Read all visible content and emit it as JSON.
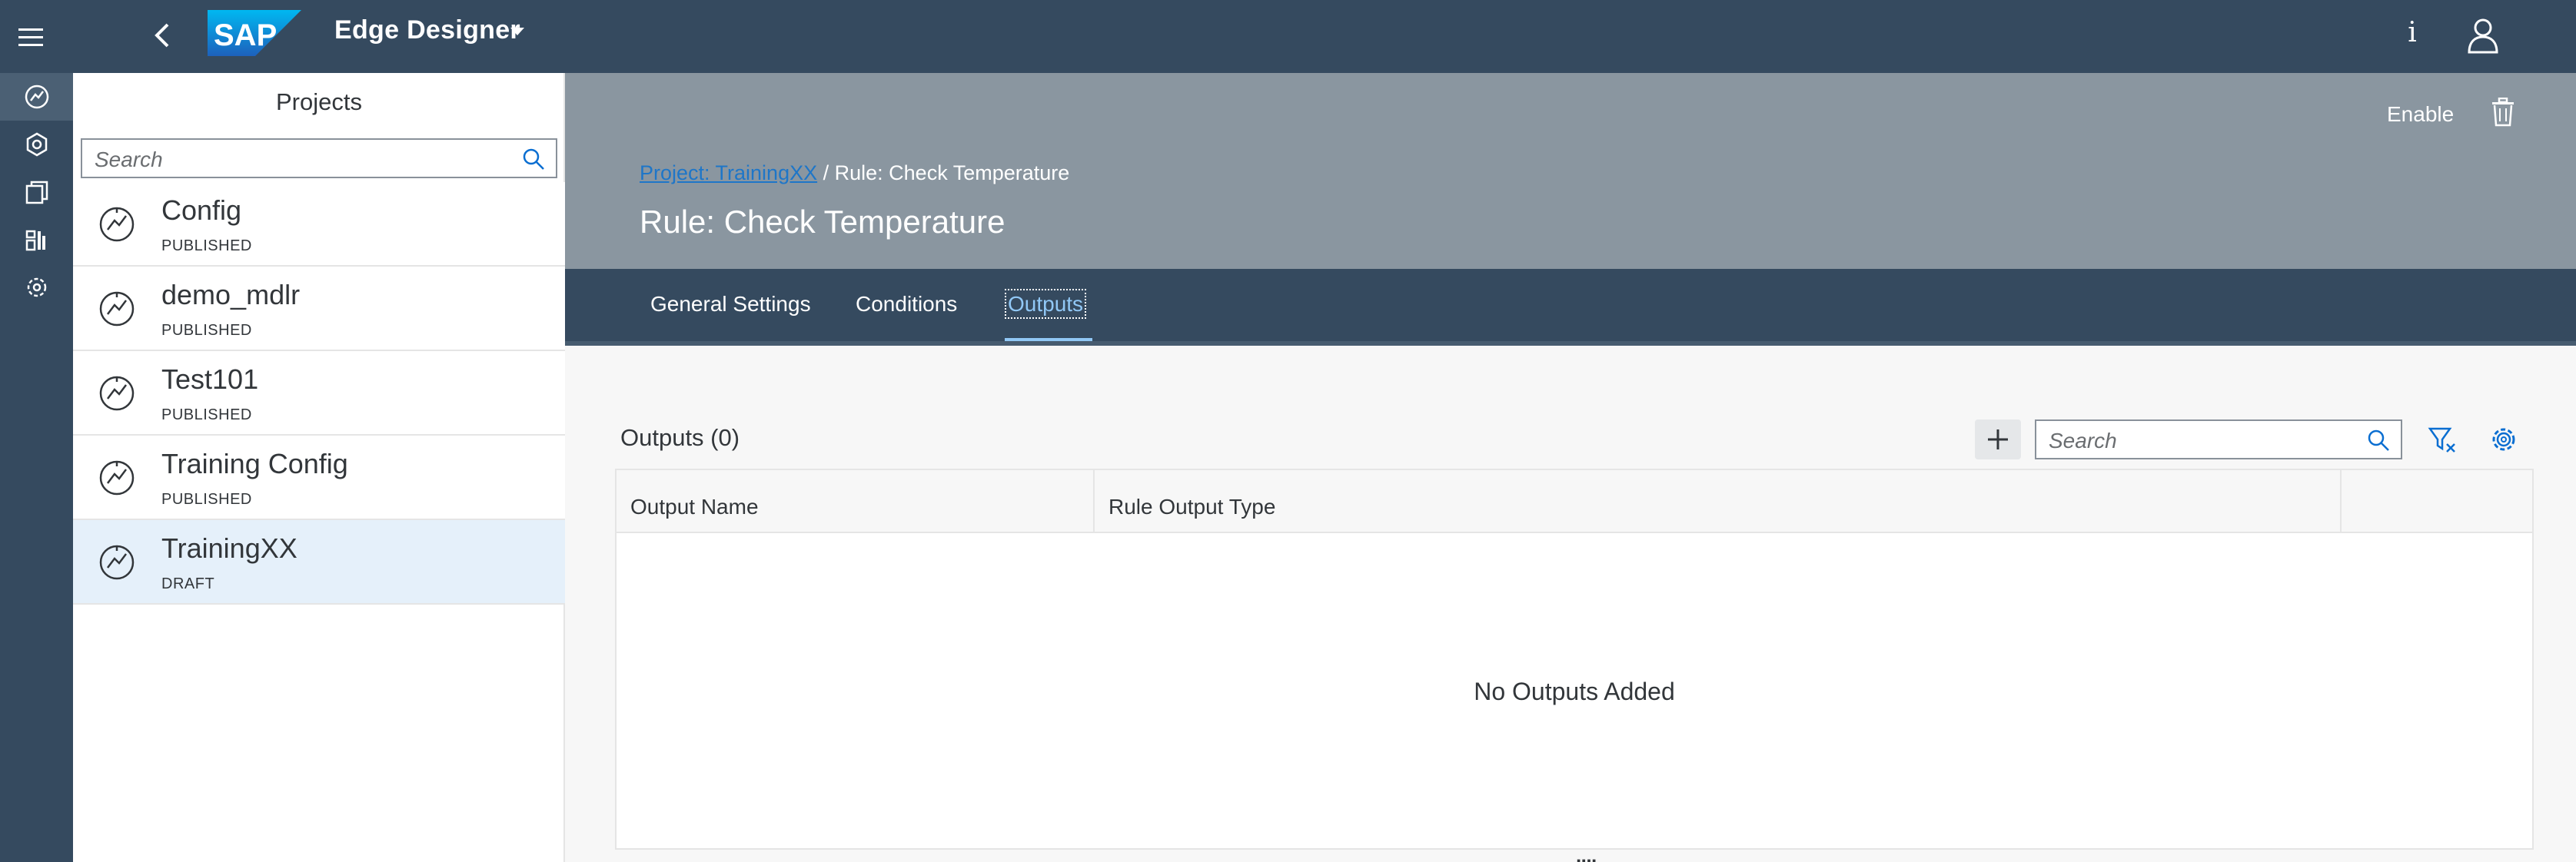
{
  "shell": {
    "app_title": "Edge Designer",
    "logo_text": "SAP",
    "info_glyph": "i"
  },
  "rail": {
    "items": [
      {
        "icon": "project-icon",
        "active": true
      },
      {
        "icon": "settings-network-icon",
        "active": false
      },
      {
        "icon": "copy-icon",
        "active": false
      },
      {
        "icon": "dashboard-icon",
        "active": false
      },
      {
        "icon": "admin-settings-icon",
        "active": false
      }
    ]
  },
  "projects": {
    "heading": "Projects",
    "search_placeholder": "Search",
    "items": [
      {
        "name": "Config",
        "status": "PUBLISHED"
      },
      {
        "name": "demo_mdlr",
        "status": "PUBLISHED"
      },
      {
        "name": "Test101",
        "status": "PUBLISHED"
      },
      {
        "name": "Training Config",
        "status": "PUBLISHED"
      },
      {
        "name": "TrainingXX",
        "status": "DRAFT",
        "selected": true
      }
    ]
  },
  "header": {
    "enable_label": "Enable",
    "breadcrumb_link": "Project: TrainingXX",
    "breadcrumb_separator": " / ",
    "breadcrumb_current": "Rule: Check Temperature",
    "title": "Rule: Check Temperature"
  },
  "tabs": [
    {
      "label": "General Settings",
      "selected": false
    },
    {
      "label": "Conditions",
      "selected": false
    },
    {
      "label": "Outputs",
      "selected": true
    }
  ],
  "outputs": {
    "title": "Outputs (0)",
    "search_placeholder": "Search",
    "columns": [
      "Output Name",
      "Rule Output Type",
      ""
    ],
    "empty_text": "No Outputs Added",
    "resize_grip": "····"
  },
  "colors": {
    "shell": "#354a5f",
    "header_bg": "#8a96a0",
    "link": "#1e76c8",
    "selected_row": "#e5f0fa",
    "tab_selected": "#91c8f6"
  }
}
